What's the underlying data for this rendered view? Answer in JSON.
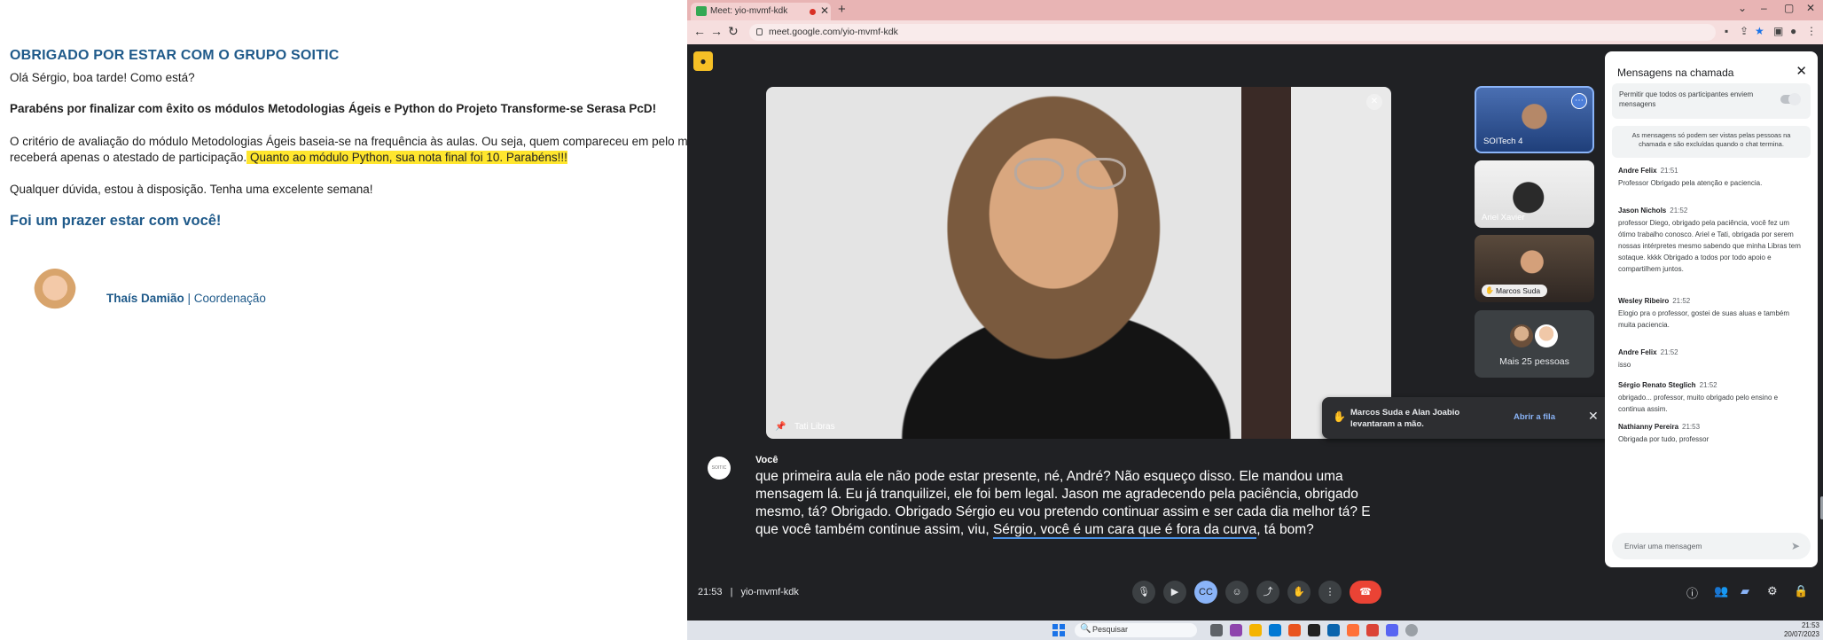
{
  "email": {
    "title": "OBRIGADO POR ESTAR COM O GRUPO SOITIC",
    "greeting": "Olá Sérgio, boa tarde! Como está?",
    "congrats": "Parabéns por finalizar com êxito os módulos Metodologias Ágeis e Python do Projeto Transforme-se Serasa PcD!",
    "criteria_line1": "O critério de avaliação do módulo Metodologias Ágeis baseia-se na frequência às aulas. Ou seja, quem compareceu em pelo menos",
    "criteria_line2": "receberá apenas o atestado de participação.",
    "highlight": " Quanto ao módulo Python, sua nota final foi 10. Parabéns!!!",
    "doubts": "Qualquer dúvida, estou à disposição. Tenha uma excelente semana!",
    "closing": "Foi um prazer estar com você!",
    "signature_name": "Thaís Damião",
    "signature_sep": " | ",
    "signature_role": "Coordenação"
  },
  "browser": {
    "tab_title": "Meet: yio-mvmf-kdk",
    "url": "meet.google.com/yio-mvmf-kdk",
    "new_tab": "+",
    "tab_close": "✕"
  },
  "meet": {
    "main_participant": "Tati Libras",
    "tiles": [
      {
        "name": "SOITech 4"
      },
      {
        "name": "Ariel Xavier"
      },
      {
        "name": "Marcos Suda"
      }
    ],
    "more_people": "Mais 25 pessoas",
    "hand_toast": {
      "text": "Marcos Suda e Alan Joabio levantaram a mão.",
      "action": "Abrir a fila"
    },
    "caption": {
      "speaker": "Você",
      "avatar_text": "SOITIC",
      "text_a": "que primeira aula ele não pode estar presente, né, André? Não esqueço disso. Ele mandou uma mensagem lá. Eu já tranquilizei, ele foi bem legal. Jason me agradecendo pela paciência, obrigado mesmo, tá? Obrigado. Obrigado Sérgio eu vou pretendo continuar assim e ser cada dia melhor tá? E que você também continue assim, viu, ",
      "text_underlined": "Sérgio, você é um cara que é fora da curva",
      "text_b": ", tá bom?"
    },
    "time": "21:53",
    "separator": "|",
    "meeting_code": "yio-mvmf-kdk",
    "participants_count": "29"
  },
  "chat": {
    "title": "Mensagens na chamada",
    "allow_label": "Permitir que todos os participantes enviem mensagens",
    "notice": "As mensagens só podem ser vistas pelas pessoas na chamada e são excluídas quando o chat termina.",
    "messages": [
      {
        "author": "Andre Felix",
        "time": "21:51",
        "text": "Professor Obrigado pela atenção e paciencia."
      },
      {
        "author": "Jason Nichols",
        "time": "21:52",
        "text": "professor Diego, obrigado pela paciência, você fez um ótimo trabalho conosco. Ariel e Tati, obrigada por serem nossas intérpretes mesmo sabendo que minha Libras tem sotaque. kkkk Obrigado a todos por todo apoio e compartilhem juntos."
      },
      {
        "author": "Wesley Ribeiro",
        "time": "21:52",
        "text": "Elogio pra o professor, gostei de suas aluas e também muita paciencia."
      },
      {
        "author": "Andre Felix",
        "time": "21:52",
        "text": "isso"
      },
      {
        "author": "Sérgio Renato Steglich",
        "time": "21:52",
        "text": "obrigado... professor, muito obrigado pelo ensino e continua assim."
      },
      {
        "author": "Nathianny Pereira",
        "time": "21:53",
        "text": "Obrigada por tudo, professor"
      }
    ],
    "input_placeholder": "Enviar uma mensagem"
  },
  "taskbar": {
    "search": "Pesquisar",
    "clock_time": "21:53",
    "clock_date": "20/07/2023"
  },
  "colors": {
    "meet_bg": "#202124",
    "accent_blue": "#8ab4f8",
    "end_call_red": "#ea4335",
    "email_title": "#1f5a8a",
    "highlight": "#ffe62e"
  },
  "icons": {
    "record": "record-icon",
    "mic": "mic-icon",
    "camera": "camera-icon",
    "captions": "captions-icon",
    "emoji": "emoji-icon",
    "present": "present-icon",
    "hand": "hand-icon",
    "more": "more-icon",
    "end_call": "end-call-icon"
  }
}
